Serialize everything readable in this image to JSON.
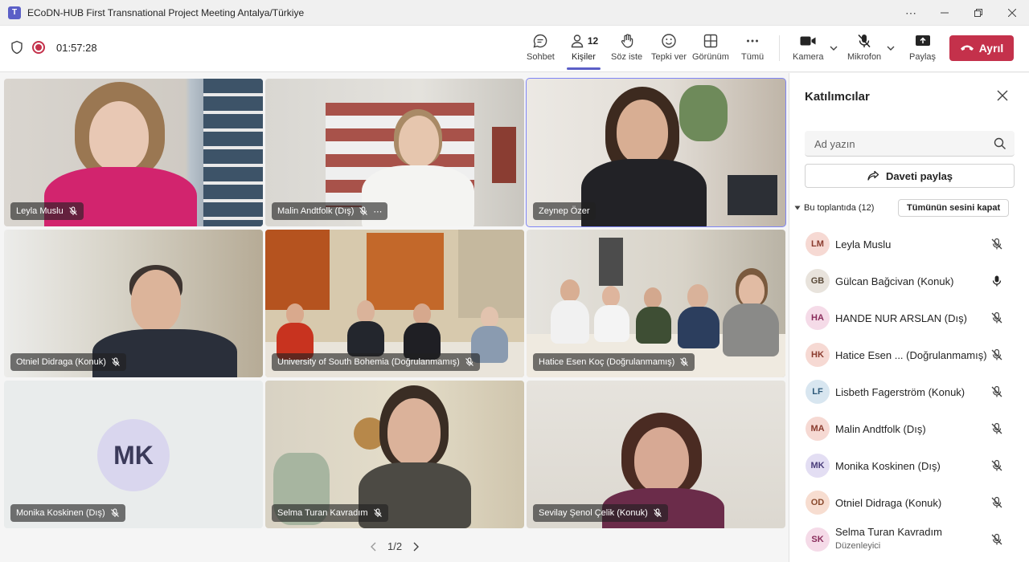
{
  "window": {
    "title": "ECoDN-HUB First Transnational Project Meeting Antalya/Türkiye",
    "app_icon": "teams-icon"
  },
  "toolbar": {
    "timer": "01:57:28",
    "chat_label": "Sohbet",
    "people_label": "Kişiler",
    "people_count": "12",
    "raise_hand_label": "Söz iste",
    "react_label": "Tepki ver",
    "view_label": "Görünüm",
    "more_label": "Tümü",
    "camera_label": "Kamera",
    "mic_label": "Mikrofon",
    "share_label": "Paylaş",
    "leave_label": "Ayrıl"
  },
  "stage": {
    "tiles": [
      {
        "name": "Leyla Muslu",
        "more": ""
      },
      {
        "name": "Malin Andtfolk (Dış)",
        "more": "⋯"
      },
      {
        "name": "Zeynep Özer"
      },
      {
        "name": "Otniel Didraga (Konuk)"
      },
      {
        "name": "University of South Bohemia (Doğrulanmamış)"
      },
      {
        "name": "Hatice Esen Koç (Doğrulanmamış)"
      },
      {
        "name": "Monika Koskinen (Dış)",
        "initials": "MK"
      },
      {
        "name": "Selma Turan Kavradım"
      },
      {
        "name": "Sevilay Şenol Çelik (Konuk)"
      }
    ],
    "pager": "1/2"
  },
  "panel": {
    "title": "Katılımcılar",
    "search_placeholder": "Ad yazın",
    "share_invite": "Daveti paylaş",
    "section_label": "Bu toplantıda (12)",
    "mute_all": "Tümünün sesini kapat",
    "participants": [
      {
        "initials": "LM",
        "name": "Leyla Muslu",
        "mic": "muted",
        "color": "#f6d9d3"
      },
      {
        "initials": "GB",
        "name": "Gülcan Bağcivan (Konuk)",
        "mic": "on",
        "color": "#e8e3dc"
      },
      {
        "initials": "HA",
        "name": "HANDE NUR ARSLAN (Dış)",
        "mic": "muted",
        "color": "#f5dbe8"
      },
      {
        "initials": "HK",
        "name": "Hatice Esen ... (Doğrulanmamış)",
        "mic": "muted",
        "color": "#f6d9d3"
      },
      {
        "initials": "LF",
        "name": "Lisbeth Fagerström (Konuk)",
        "mic": "muted",
        "color": "#d8e6f0"
      },
      {
        "initials": "MA",
        "name": "Malin Andtfolk (Dış)",
        "mic": "muted",
        "color": "#f6d9d3"
      },
      {
        "initials": "MK",
        "name": "Monika Koskinen (Dış)",
        "mic": "muted",
        "color": "#e3def3"
      },
      {
        "initials": "OD",
        "name": "Otniel Didraga (Konuk)",
        "mic": "muted",
        "color": "#f7ddd0"
      },
      {
        "initials": "SK",
        "name": "Selma Turan Kavradım",
        "sub": "Düzenleyici",
        "mic": "muted",
        "color": "#f5dbe8"
      }
    ]
  },
  "colors": {
    "accent": "#5b5fc7",
    "leave": "#c4314b",
    "selected_outline": "#7f85f5"
  }
}
